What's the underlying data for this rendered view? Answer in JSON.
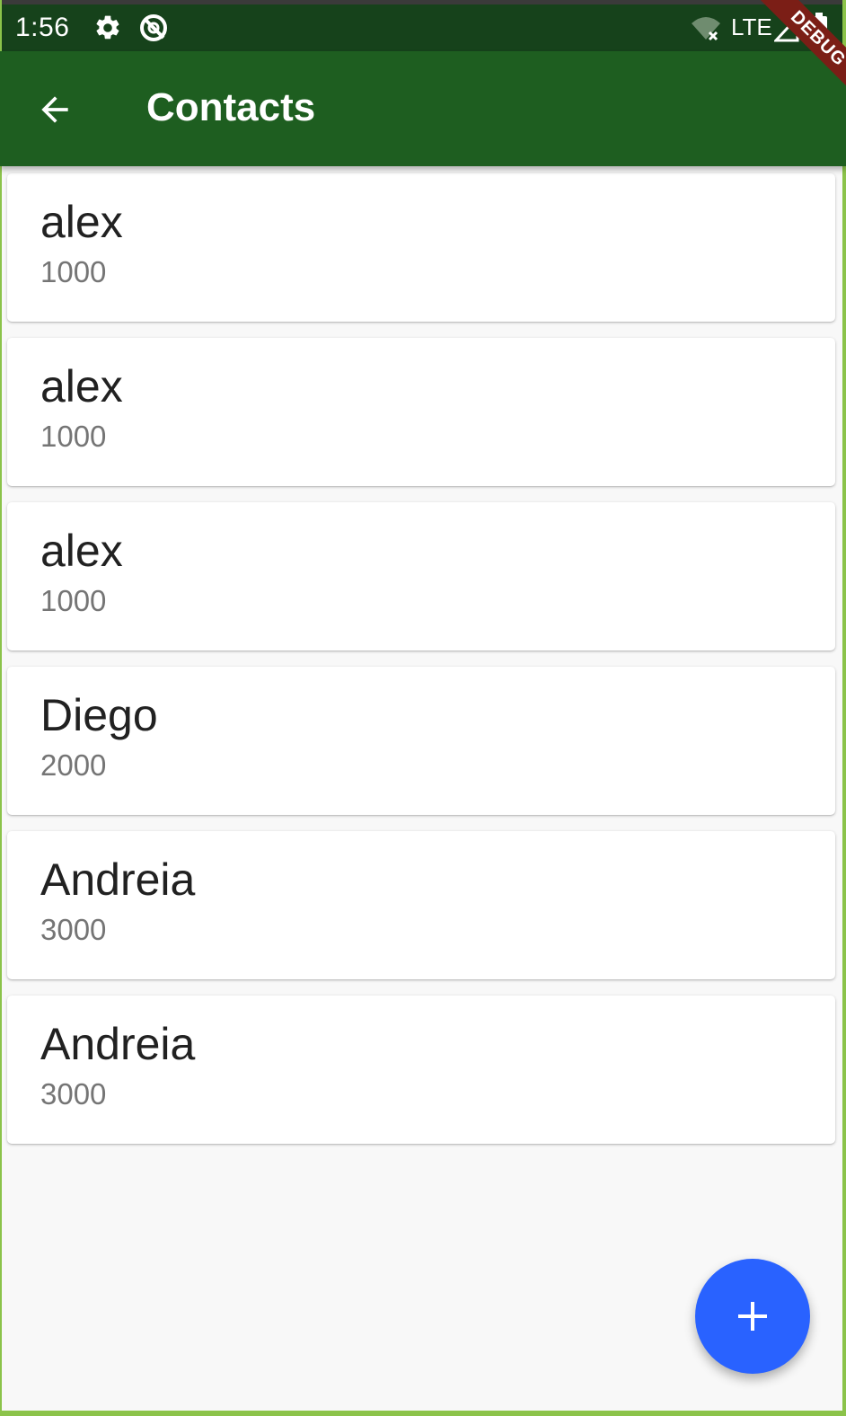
{
  "status_bar": {
    "time": "1:56",
    "network": "LTE",
    "icons": [
      "gear-icon",
      "vpn-q-icon",
      "wifi-off-icon",
      "signal-icon",
      "battery-icon"
    ]
  },
  "app_bar": {
    "title": "Contacts",
    "back_icon": "arrow-back-icon",
    "debug_label": "DEBUG"
  },
  "contacts": [
    {
      "name": "alex",
      "value": "1000"
    },
    {
      "name": "alex",
      "value": "1000"
    },
    {
      "name": "alex",
      "value": "1000"
    },
    {
      "name": "Diego",
      "value": "2000"
    },
    {
      "name": "Andreia",
      "value": "3000"
    },
    {
      "name": "Andreia",
      "value": "3000"
    }
  ],
  "fab": {
    "icon": "add-icon"
  },
  "colors": {
    "status_bar": "#16421b",
    "app_bar": "#1e5e20",
    "fab": "#2962ff",
    "debug_banner": "#7b1e16",
    "background": "#f8f8f8"
  }
}
